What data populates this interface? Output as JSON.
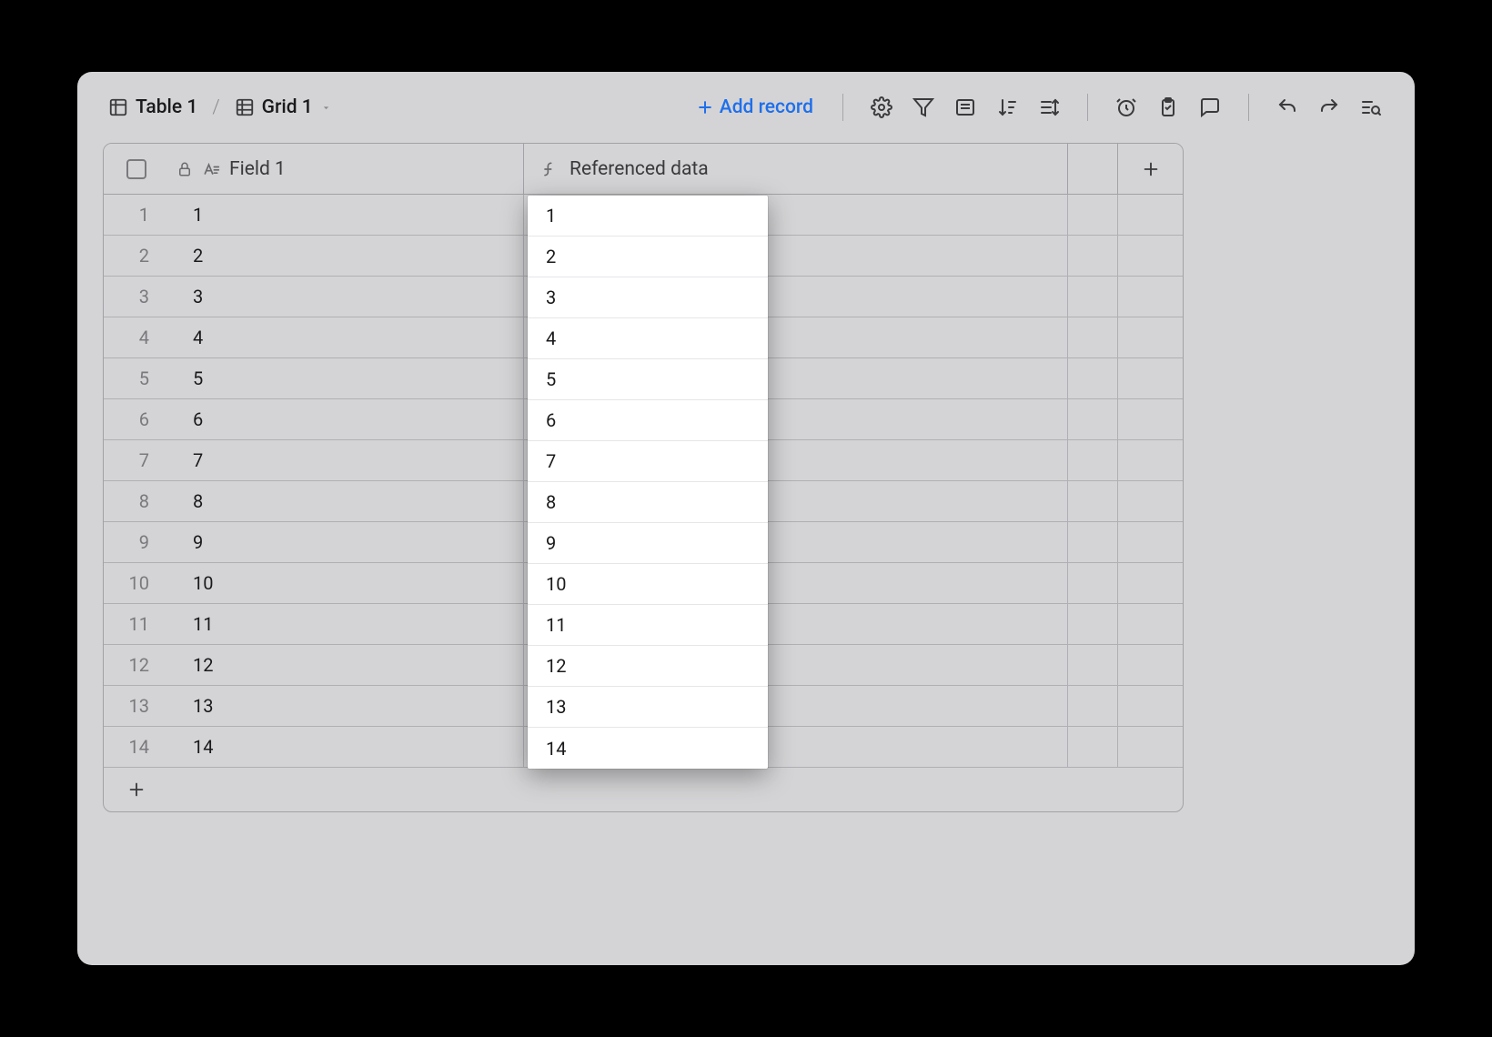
{
  "breadcrumb": {
    "table_label": "Table 1",
    "view_label": "Grid 1"
  },
  "toolbar": {
    "add_record_label": "Add record"
  },
  "columns": {
    "field1_label": "Field 1",
    "refdata_label": "Referenced data"
  },
  "rows": [
    {
      "num": "1",
      "field1": "1",
      "ref": "1"
    },
    {
      "num": "2",
      "field1": "2",
      "ref": "2"
    },
    {
      "num": "3",
      "field1": "3",
      "ref": "3"
    },
    {
      "num": "4",
      "field1": "4",
      "ref": "4"
    },
    {
      "num": "5",
      "field1": "5",
      "ref": "5"
    },
    {
      "num": "6",
      "field1": "6",
      "ref": "6"
    },
    {
      "num": "7",
      "field1": "7",
      "ref": "7"
    },
    {
      "num": "8",
      "field1": "8",
      "ref": "8"
    },
    {
      "num": "9",
      "field1": "9",
      "ref": "9"
    },
    {
      "num": "10",
      "field1": "10",
      "ref": "10"
    },
    {
      "num": "11",
      "field1": "11",
      "ref": "11"
    },
    {
      "num": "12",
      "field1": "12",
      "ref": "12"
    },
    {
      "num": "13",
      "field1": "13",
      "ref": "13"
    },
    {
      "num": "14",
      "field1": "14",
      "ref": "14"
    }
  ]
}
